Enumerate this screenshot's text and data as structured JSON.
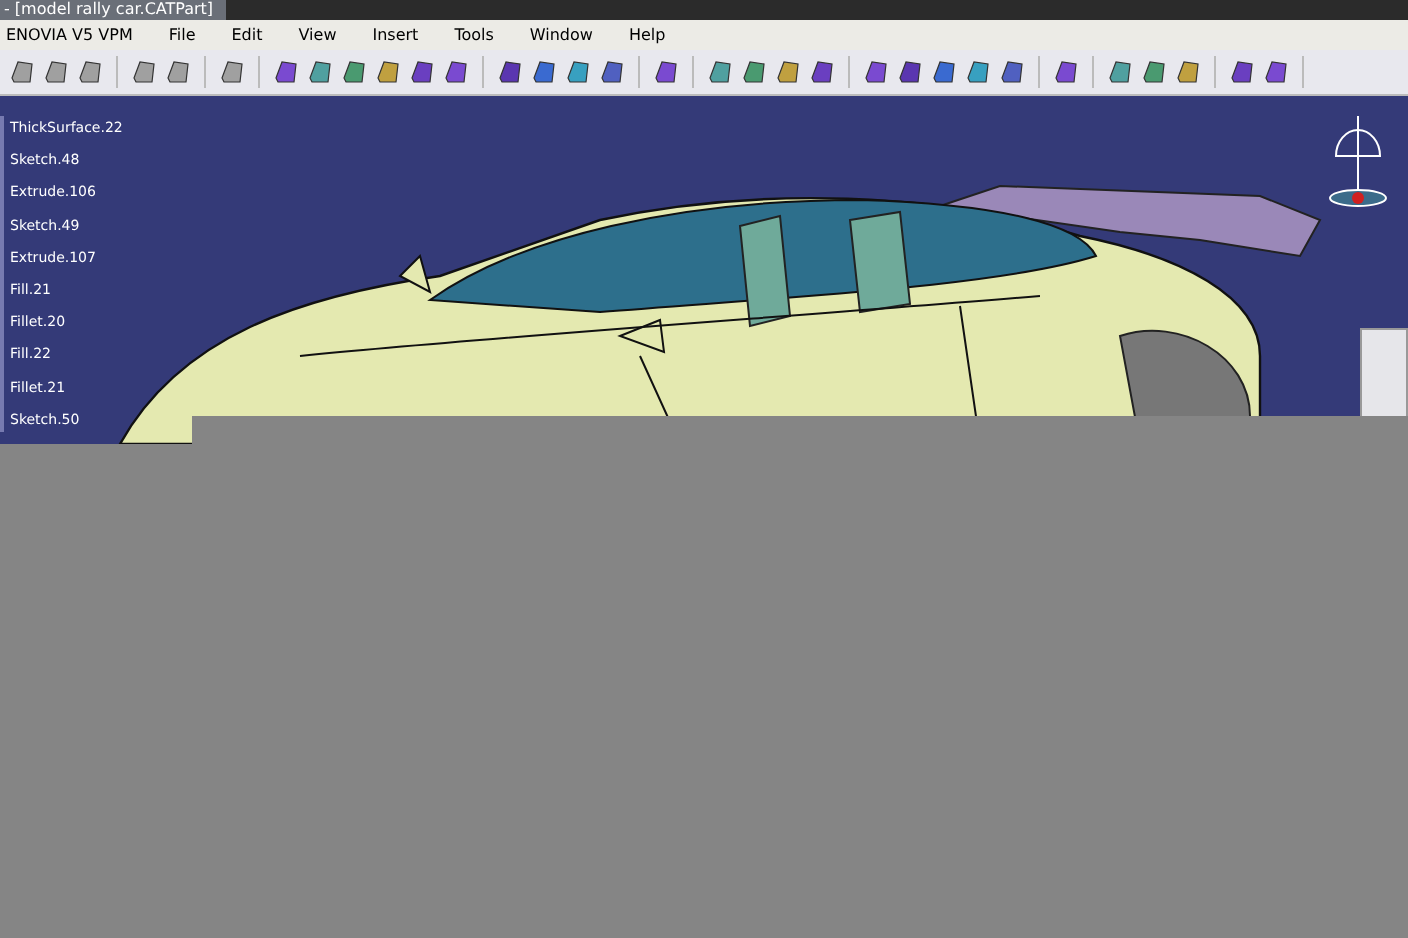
{
  "window": {
    "title": "- [model rally car.CATPart]"
  },
  "menu": [
    "ENOVIA V5 VPM",
    "File",
    "Edit",
    "View",
    "Insert",
    "Tools",
    "Window",
    "Help"
  ],
  "tree": [
    "ThickSurface.22",
    "Sketch.48",
    "Extrude.106",
    "Sketch.49",
    "Extrude.107",
    "Fill.21",
    "Fillet.20",
    "Fill.22",
    "Fillet.21",
    "Sketch.50"
  ]
}
